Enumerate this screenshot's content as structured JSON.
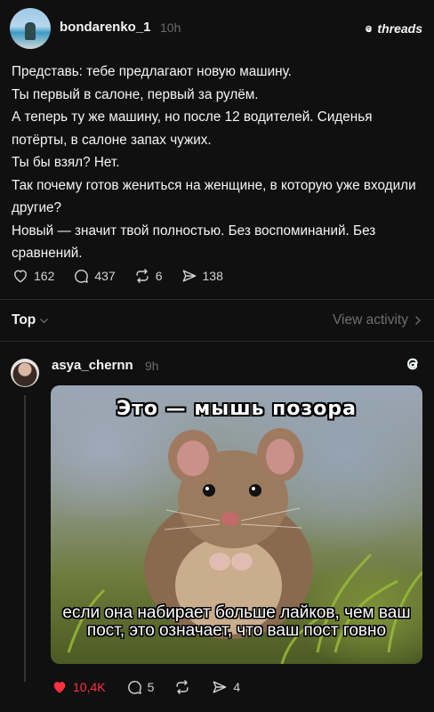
{
  "post": {
    "username": "bondarenko_1",
    "time": "10h",
    "brand": "threads",
    "lines": [
      "Представь: тебе предлагают новую машину.",
      "Ты первый в салоне, первый за рулём.",
      "А теперь ту же машину, но после 12 водителей. Сиденья потёрты, в салоне запах чужих.",
      "Ты бы взял? Нет.",
      "Так почему готов жениться на женщине, в которую уже входили другие?",
      "Новый — значит твой полностью. Без воспоминаний. Без сравнений."
    ],
    "likes": "162",
    "comments": "437",
    "reposts": "6",
    "shares": "138"
  },
  "sort": {
    "label": "Top",
    "view_activity": "View activity"
  },
  "reply": {
    "username": "asya_chernn",
    "time": "9h",
    "meme_top": "Это — мышь позора",
    "meme_bottom": "если она набирает больше лайков, чем ваш пост, это означает, что ваш пост говно",
    "likes": "10,4K",
    "comments": "5",
    "shares": "4"
  },
  "colors": {
    "background": "#101010",
    "text": "#f3f5f7",
    "muted": "#6a6a6a",
    "like_active": "#ff3040"
  }
}
